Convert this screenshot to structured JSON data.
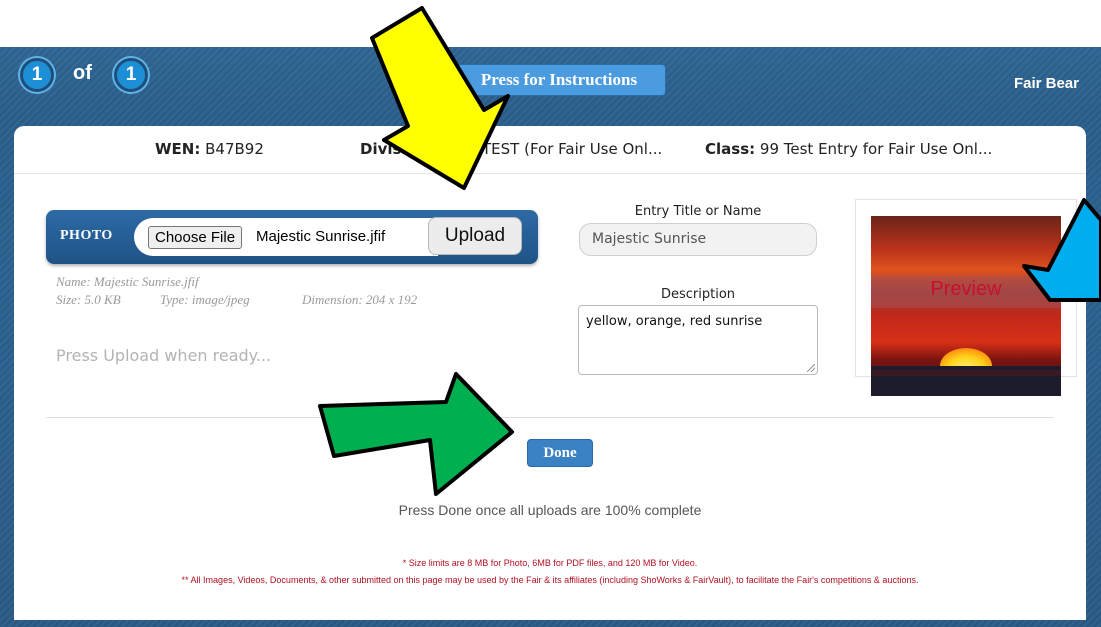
{
  "pager": {
    "current": "1",
    "of_label": "of",
    "total": "1"
  },
  "header": {
    "instructions_label": "Press for Instructions",
    "user_name": "Fair Bear"
  },
  "entry_info": {
    "wen_label": "WEN:",
    "wen_value": "B47B92",
    "division_label": "Divisi",
    "division_value": "TEST (For Fair Use Onl...",
    "class_label": "Class:",
    "class_value": "99 Test Entry for Fair Use Onl..."
  },
  "upload": {
    "photo_label": "PHOTO",
    "choose_file_label": "Choose File",
    "file_name": "Majestic Sunrise.jfif",
    "upload_label": "Upload",
    "meta_name": "Name: Majestic Sunrise.jfif",
    "meta_size": "Size: 5.0 KB",
    "meta_type": "Type: image/jpeg",
    "meta_dimension": "Dimension: 204 x 192",
    "ready_text": "Press Upload when ready..."
  },
  "form": {
    "title_label": "Entry Title or Name",
    "title_value": "Majestic Sunrise",
    "description_label": "Description",
    "description_value": "yellow, orange, red sunrise"
  },
  "preview": {
    "label": "Preview"
  },
  "actions": {
    "done_label": "Done",
    "done_hint": "Press Done once all uploads are 100% complete"
  },
  "footer": {
    "size_limits": "* Size limits are 8 MB for Photo, 6MB for PDF files, and 120 MB for Video.",
    "usage_notice": "** All Images, Videos, Documents, & other submitted on this page may be used by the Fair & its affiliates (including ShoWorks & FairVault), to facilitate the Fair's competitions & auctions."
  },
  "colors": {
    "frame_blue": "#2b6290",
    "accent_blue": "#4a9be0",
    "arrow_yellow": "#ffff00",
    "arrow_green": "#00b050",
    "arrow_cyan": "#00aeef",
    "footer_red": "#b01020"
  }
}
